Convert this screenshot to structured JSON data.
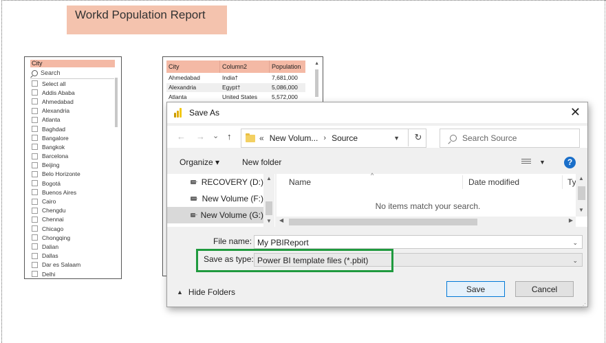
{
  "report": {
    "title": "Workd Population Report"
  },
  "slicer": {
    "header": "City",
    "search_placeholder": "Search",
    "items": [
      "Select all",
      "Addis Ababa",
      "Ahmedabad",
      "Alexandria",
      "Atlanta",
      "Baghdad",
      "Bangalore",
      "Bangkok",
      "Barcelona",
      "Beijing",
      "Belo Horizonte",
      "Bogotá",
      "Buenos Aires",
      "Cairo",
      "Chengdu",
      "Chennai",
      "Chicago",
      "Chongqing",
      "Dalian",
      "Dallas",
      "Dar es Salaam",
      "Delhi"
    ]
  },
  "table": {
    "columns": [
      "City",
      "Column2",
      "Population"
    ],
    "rows": [
      [
        "Ahmedabad",
        "India†",
        "7,681,000"
      ],
      [
        "Alexandria",
        "Egypt†",
        "5,086,000"
      ],
      [
        "Atlanta",
        "United States",
        "5,572,000"
      ]
    ]
  },
  "dialog": {
    "title": "Save As",
    "close": "✕",
    "address": {
      "part1": "New Volum...",
      "part2": "Source",
      "chevrons": "«",
      "separator": "›"
    },
    "search_placeholder": "Search Source",
    "toolbar": {
      "organize": "Organize ▾",
      "new_folder": "New folder"
    },
    "nav_items": [
      "RECOVERY (D:)",
      "New Volume (F:)",
      "New Volume (G:)"
    ],
    "columns": {
      "name": "Name",
      "date": "Date modified",
      "type": "Ty"
    },
    "empty_message": "No items match your search.",
    "file_name_label": "File name:",
    "file_name_value": "My PBIReport",
    "save_type_label": "Save as type:",
    "save_type_value": "Power BI template files (*.pbit)",
    "hide_folders": "Hide Folders",
    "save_button": "Save",
    "cancel_button": "Cancel"
  },
  "colors": {
    "title_bg": "#f4c3ae",
    "header_bg": "#f4b9a5",
    "highlight": "#1f9a3e",
    "accent": "#0078d7"
  },
  "icons": {
    "back": "←",
    "forward": "→",
    "recent": "⌄",
    "up": "↑",
    "refresh": "↻",
    "help": "?"
  }
}
